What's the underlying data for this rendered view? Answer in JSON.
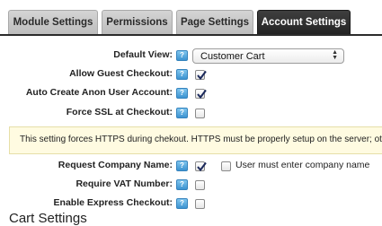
{
  "tabs": [
    {
      "label": "Module Settings",
      "active": false
    },
    {
      "label": "Permissions",
      "active": false
    },
    {
      "label": "Page Settings",
      "active": false
    },
    {
      "label": "Account Settings",
      "active": true
    }
  ],
  "colors": {
    "active_tab": "#2b2b2b",
    "help_icon": "#4aa3dc",
    "notice_bg": "#fffbe1"
  },
  "fields": {
    "default_view": {
      "label": "Default View:",
      "value": "Customer Cart"
    },
    "allow_guest_checkout": {
      "label": "Allow Guest Checkout:",
      "checked": true
    },
    "auto_create_anon_user": {
      "label": "Auto Create Anon User Account:",
      "checked": true
    },
    "force_ssl": {
      "label": "Force SSL at Checkout:",
      "checked": false
    },
    "request_company_name": {
      "label": "Request Company Name:",
      "checked": true,
      "extra_label": "User must enter company name",
      "extra_checked": false
    },
    "require_vat": {
      "label": "Require VAT Number:",
      "checked": false
    },
    "enable_express_checkout": {
      "label": "Enable Express Checkout:",
      "checked": false
    }
  },
  "notice": "This setting forces HTTPS during chekout. HTTPS must be properly setup on the server; othe",
  "section_title": "Cart Settings",
  "help_icon_glyph": "?"
}
